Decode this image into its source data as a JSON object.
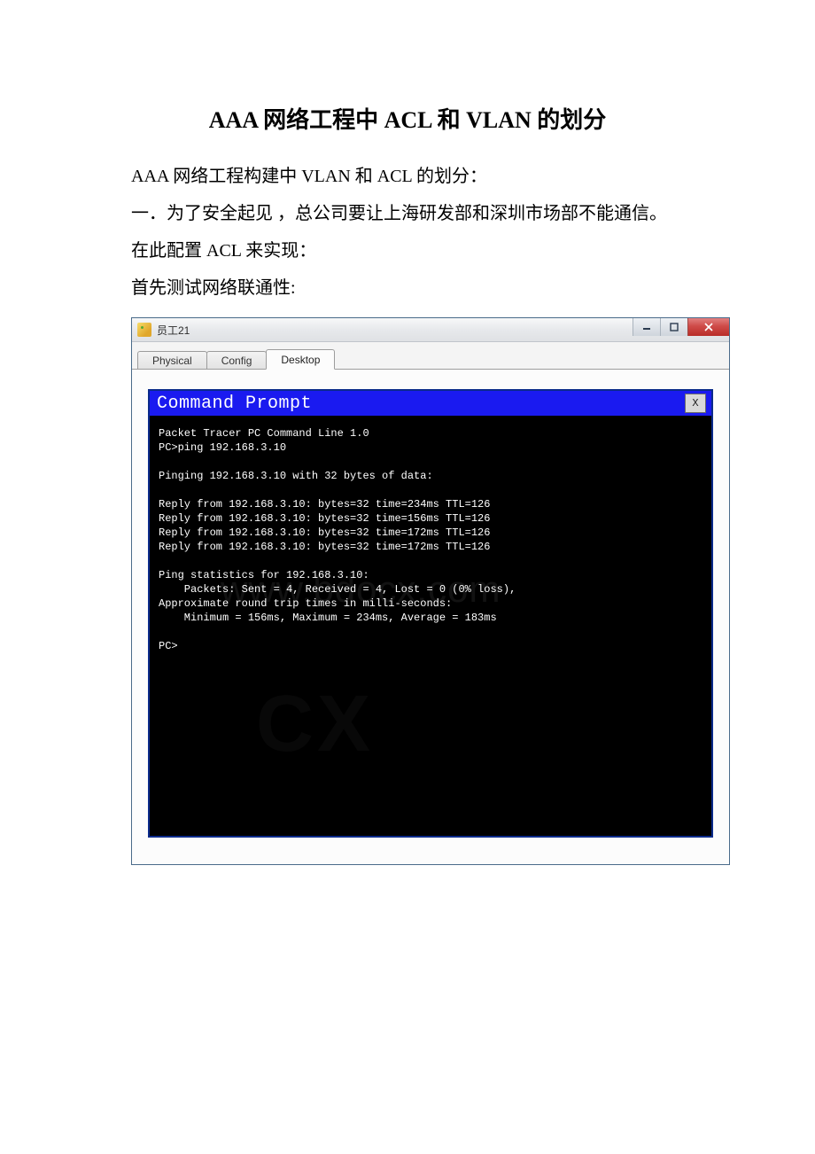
{
  "doc": {
    "title": "AAA 网络工程中 ACL 和 VLAN 的划分",
    "line1": "AAA 网络工程构建中 VLAN 和 ACL 的划分：",
    "line2": "一．为了安全起见 ，总公司要让上海研发部和深圳市场部不能通信。",
    "line3": "在此配置 ACL 来实现：",
    "line4": "首先测试网络联通性:"
  },
  "window": {
    "title": "员工21",
    "tabs": {
      "physical": "Physical",
      "config": "Config",
      "desktop": "Desktop"
    }
  },
  "cmd": {
    "title": "Command Prompt",
    "close": "X",
    "lines": "Packet Tracer PC Command Line 1.0\nPC>ping 192.168.3.10\n\nPinging 192.168.3.10 with 32 bytes of data:\n\nReply from 192.168.3.10: bytes=32 time=234ms TTL=126\nReply from 192.168.3.10: bytes=32 time=156ms TTL=126\nReply from 192.168.3.10: bytes=32 time=172ms TTL=126\nReply from 192.168.3.10: bytes=32 time=172ms TTL=126\n\nPing statistics for 192.168.3.10:\n    Packets: Sent = 4, Received = 4, Lost = 0 (0% loss),\nApproximate round trip times in milli-seconds:\n    Minimum = 156ms, Maximum = 234ms, Average = 183ms\n\nPC>"
  },
  "watermark": {
    "w1": "www.bdocx.com",
    "w2": "CX"
  }
}
